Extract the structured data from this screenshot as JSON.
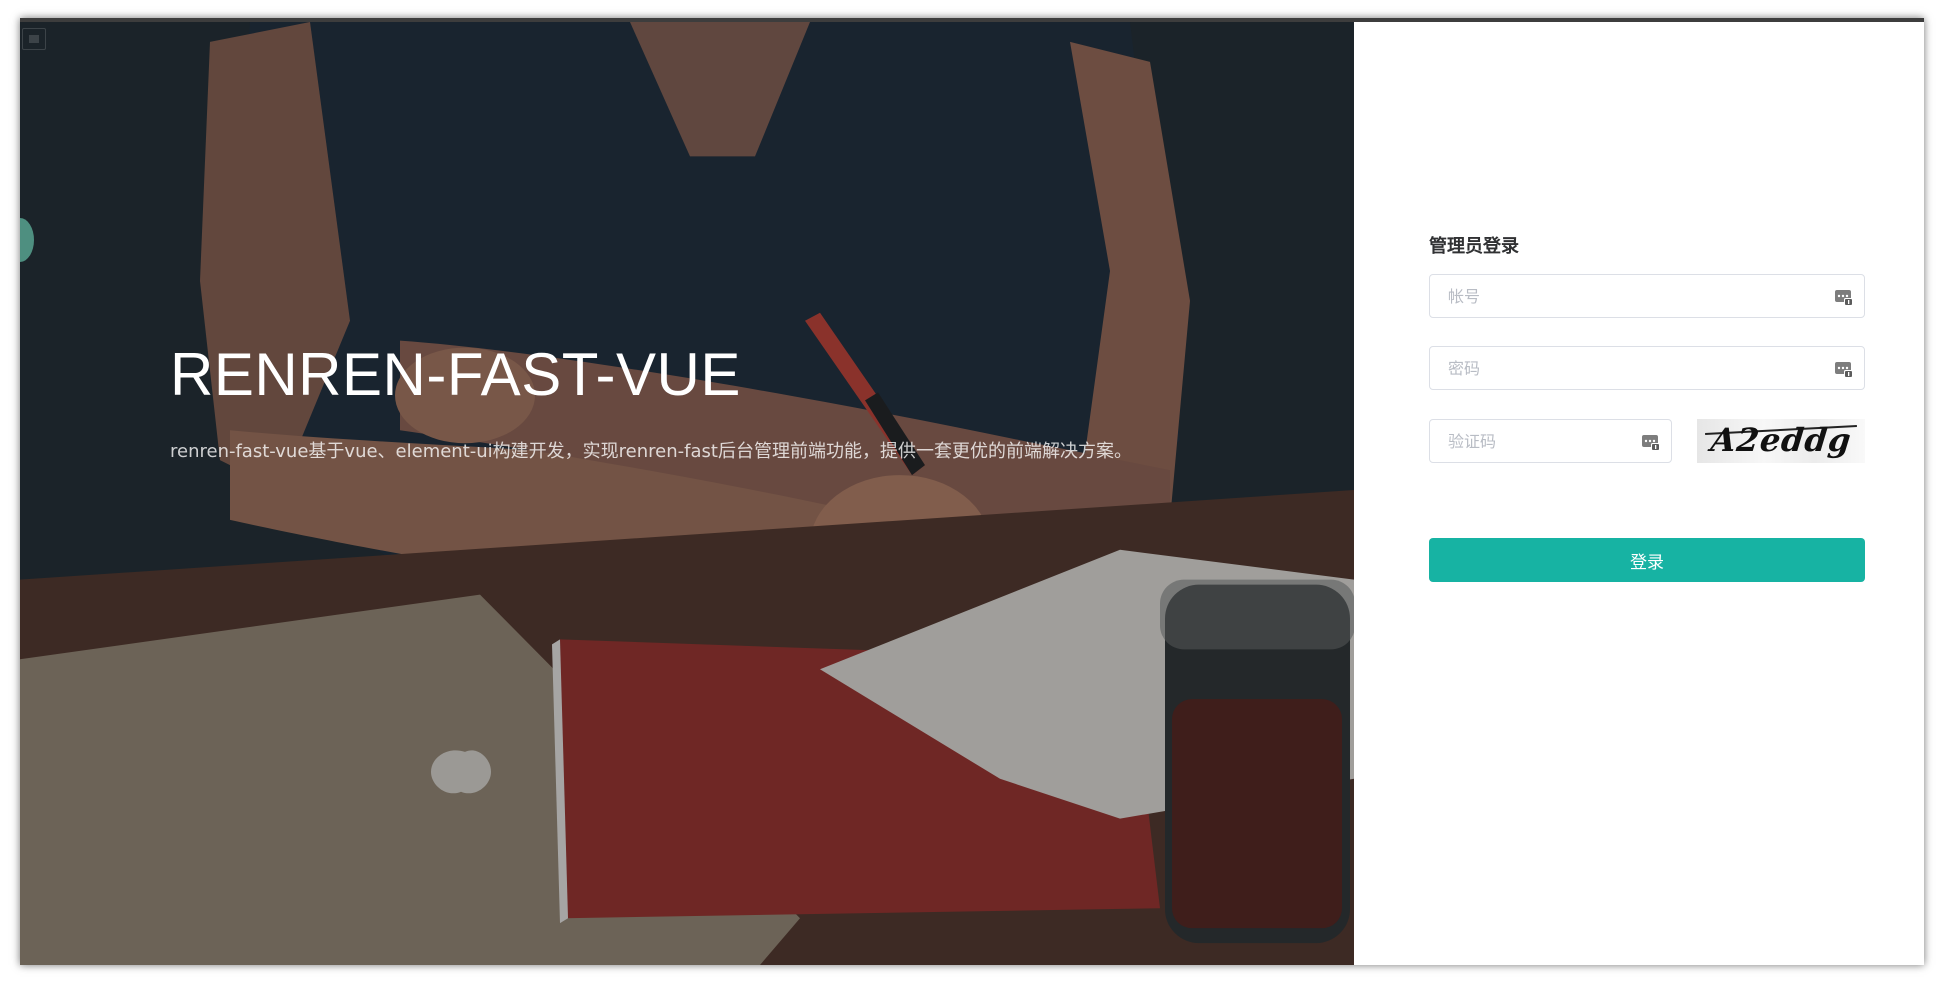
{
  "hero": {
    "brand": "RENREN-FAST-VUE",
    "description": "renren-fast-vue基于vue、element-ui构建开发，实现renren-fast后台管理前端功能，提供一套更优的前端解决方案。"
  },
  "login": {
    "title": "管理员登录",
    "account_placeholder": "帐号",
    "password_placeholder": "密码",
    "captcha_placeholder": "验证码",
    "captcha_text": "A2eddg",
    "submit_label": "登录"
  },
  "colors": {
    "primary": "#17b3a3",
    "input_border": "#dcdfe6",
    "title": "#303133"
  },
  "icons": {
    "field_suffix": "key-icon"
  }
}
